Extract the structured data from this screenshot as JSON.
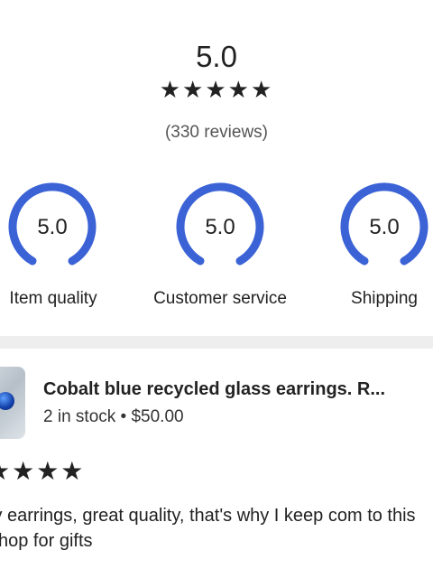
{
  "overall": {
    "score": "5.0",
    "stars": "★★★★★",
    "review_count": "(330 reviews)"
  },
  "gauges": [
    {
      "value": "5.0",
      "label": "Item quality",
      "fraction": 1.0
    },
    {
      "value": "5.0",
      "label": "Customer service",
      "fraction": 1.0
    },
    {
      "value": "5.0",
      "label": "Shipping",
      "fraction": 1.0
    }
  ],
  "review": {
    "product_title": "Cobalt blue recycled glass earrings. R...",
    "stock": "2 in stock",
    "separator": "•",
    "price": "$50.00",
    "stars": "★★★★",
    "text": "ly earrings, great quality, that's why I keep com to this shop for gifts"
  },
  "colors": {
    "accent": "#3b63d6",
    "divider": "#eeeeee"
  }
}
